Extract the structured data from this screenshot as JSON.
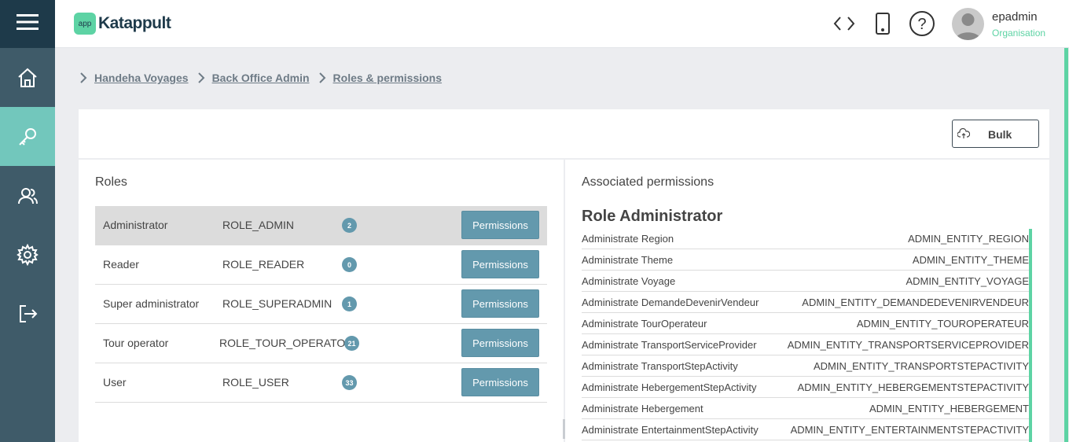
{
  "sidebar": {
    "menu_icon": "hamburger-icon",
    "items": [
      {
        "name": "home",
        "icon": "home-icon"
      },
      {
        "name": "keys",
        "icon": "key-icon",
        "active": true
      },
      {
        "name": "users",
        "icon": "users-icon"
      },
      {
        "name": "settings",
        "icon": "gear-icon"
      },
      {
        "name": "logout",
        "icon": "logout-icon"
      }
    ]
  },
  "header": {
    "logo_badge": "app",
    "logo_text": "Katappult",
    "icons": [
      "code-icon",
      "mobile-icon",
      "help-icon"
    ],
    "user": {
      "name": "epadmin",
      "org": "Organisation"
    }
  },
  "breadcrumb": [
    "Handeha Voyages",
    "Back Office Admin",
    "Roles & permissions"
  ],
  "toolbar": {
    "bulk_label": "Bulk",
    "bulk_icon": "cloud-upload-icon"
  },
  "roles": {
    "title": "Roles",
    "button_label": "Permissions",
    "rows": [
      {
        "name": "Administrator",
        "code": "ROLE_ADMIN",
        "count": "2",
        "selected": true
      },
      {
        "name": "Reader",
        "code": "ROLE_READER",
        "count": "0"
      },
      {
        "name": "Super administrator",
        "code": "ROLE_SUPERADMIN",
        "count": "1"
      },
      {
        "name": "Tour operator",
        "code": "ROLE_TOUR_OPERATOR",
        "count": "21"
      },
      {
        "name": "User",
        "code": "ROLE_USER",
        "count": "33"
      }
    ]
  },
  "permissions": {
    "title": "Associated permissions",
    "role_heading": "Role Administrator",
    "rows": [
      {
        "label": "Administrate Region",
        "code": "ADMIN_ENTITY_REGION"
      },
      {
        "label": "Administrate Theme",
        "code": "ADMIN_ENTITY_THEME"
      },
      {
        "label": "Administrate Voyage",
        "code": "ADMIN_ENTITY_VOYAGE"
      },
      {
        "label": "Administrate DemandeDevenirVendeur",
        "code": "ADMIN_ENTITY_DEMANDEDEVENIRVENDEUR"
      },
      {
        "label": "Administrate TourOperateur",
        "code": "ADMIN_ENTITY_TOUROPERATEUR"
      },
      {
        "label": "Administrate TransportServiceProvider",
        "code": "ADMIN_ENTITY_TRANSPORTSERVICEPROVIDER"
      },
      {
        "label": "Administrate TransportStepActivity",
        "code": "ADMIN_ENTITY_TRANSPORTSTEPACTIVITY"
      },
      {
        "label": "Administrate HebergementStepActivity",
        "code": "ADMIN_ENTITY_HEBERGEMENTSTEPACTIVITY"
      },
      {
        "label": "Administrate Hebergement",
        "code": "ADMIN_ENTITY_HEBERGEMENT"
      },
      {
        "label": "Administrate EntertainmentStepActivity",
        "code": "ADMIN_ENTITY_ENTERTAINMENTSTEPACTIVITY"
      }
    ]
  },
  "colors": {
    "accent": "#5dd3a4",
    "sidebar": "#3f5b69",
    "sidebar_top": "#1e3a4a",
    "active": "#72c7bc",
    "button": "#6399ad"
  }
}
